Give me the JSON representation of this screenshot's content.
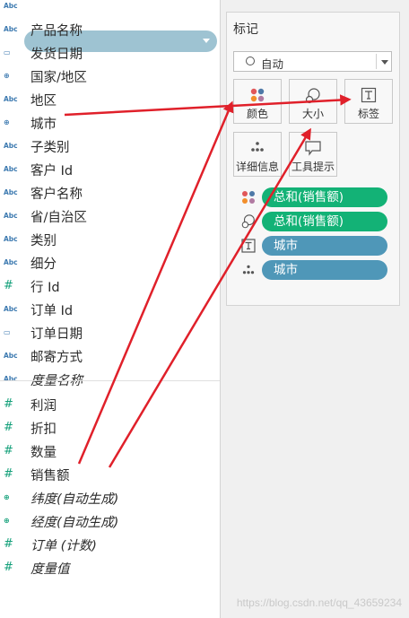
{
  "fields": [
    {
      "label": "",
      "icon": "abc",
      "icon_text": "Abc",
      "italic": false
    },
    {
      "label": "产品名称",
      "icon": "abc",
      "icon_text": "Abc",
      "italic": false
    },
    {
      "label": "发货日期",
      "icon": "cal",
      "icon_text": "▭",
      "italic": false,
      "selected": true
    },
    {
      "label": "国家/地区",
      "icon": "geo",
      "icon_text": "⊕",
      "italic": false
    },
    {
      "label": "地区",
      "icon": "abc",
      "icon_text": "Abc",
      "italic": false
    },
    {
      "label": "城市",
      "icon": "geo",
      "icon_text": "⊕",
      "italic": false
    },
    {
      "label": "子类别",
      "icon": "abc",
      "icon_text": "Abc",
      "italic": false
    },
    {
      "label": "客户 Id",
      "icon": "abc",
      "icon_text": "Abc",
      "italic": false
    },
    {
      "label": "客户名称",
      "icon": "abc",
      "icon_text": "Abc",
      "italic": false
    },
    {
      "label": "省/自治区",
      "icon": "abc",
      "icon_text": "Abc",
      "italic": false
    },
    {
      "label": "类别",
      "icon": "abc",
      "icon_text": "Abc",
      "italic": false
    },
    {
      "label": "细分",
      "icon": "abc",
      "icon_text": "Abc",
      "italic": false
    },
    {
      "label": "行 Id",
      "icon": "num",
      "icon_text": "#",
      "italic": false
    },
    {
      "label": "订单 Id",
      "icon": "abc",
      "icon_text": "Abc",
      "italic": false
    },
    {
      "label": "订单日期",
      "icon": "cal",
      "icon_text": "▭",
      "italic": false
    },
    {
      "label": "邮寄方式",
      "icon": "abc",
      "icon_text": "Abc",
      "italic": false
    },
    {
      "label": "度量名称",
      "icon": "abc",
      "icon_text": "Abc",
      "italic": true
    },
    {
      "label": "利润",
      "icon": "num",
      "icon_text": "#",
      "italic": false
    },
    {
      "label": "折扣",
      "icon": "num",
      "icon_text": "#",
      "italic": false
    },
    {
      "label": "数量",
      "icon": "num",
      "icon_text": "#",
      "italic": false
    },
    {
      "label": "销售额",
      "icon": "num",
      "icon_text": "#",
      "italic": false
    },
    {
      "label": "纬度(自动生成)",
      "icon": "geo-g",
      "icon_text": "⊕",
      "italic": true
    },
    {
      "label": "经度(自动生成)",
      "icon": "geo-g",
      "icon_text": "⊕",
      "italic": true
    },
    {
      "label": "订单 (计数)",
      "icon": "num",
      "icon_text": "#",
      "italic": true
    },
    {
      "label": "度量值",
      "icon": "num",
      "icon_text": "#",
      "italic": true
    }
  ],
  "marks": {
    "title": "标记",
    "mark_type": "自动",
    "buttons": {
      "color": "颜色",
      "size": "大小",
      "label": "标签",
      "detail": "详细信息",
      "tooltip": "工具提示"
    },
    "shelf": [
      {
        "kind": "color",
        "label": "总和(销售额)",
        "pill_color": "green"
      },
      {
        "kind": "size",
        "label": "总和(销售额)",
        "pill_color": "green"
      },
      {
        "kind": "label",
        "label": "城市",
        "pill_color": "blue"
      },
      {
        "kind": "detail",
        "label": "城市",
        "pill_color": "blue"
      }
    ]
  },
  "colors": {
    "measure_pill": "#13b276",
    "dimension_pill": "#4f97b8",
    "selected_field": "#9ec3d2",
    "arrow": "#e0202a"
  },
  "watermark": "https://blog.csdn.net/qq_43659234"
}
